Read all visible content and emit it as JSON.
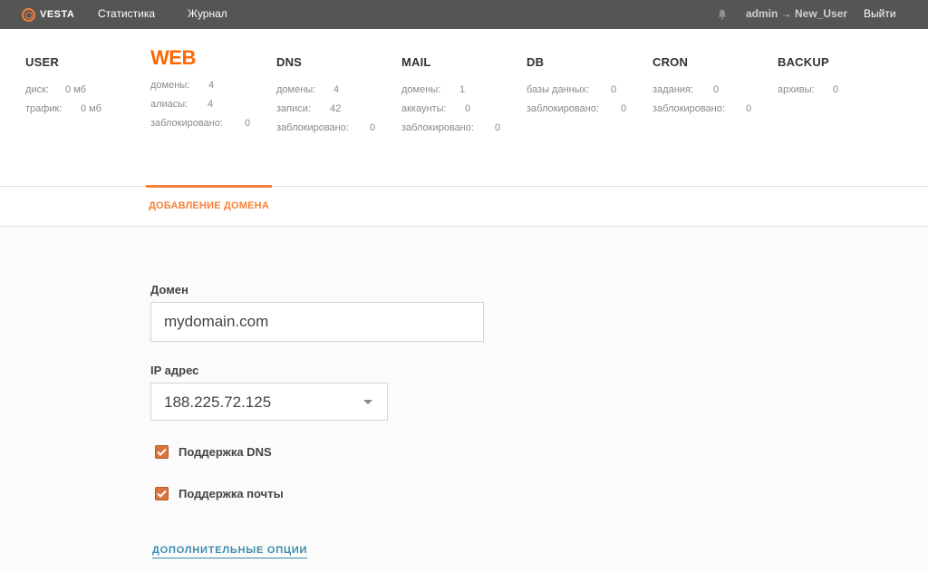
{
  "topbar": {
    "logo_text": "VESTA",
    "nav": [
      "Статистика",
      "Журнал"
    ],
    "user": "admin → New_User",
    "logout": "Выйти"
  },
  "stats": {
    "user": {
      "title": "USER",
      "rows": [
        {
          "label": "диск:",
          "value": "0 мб"
        },
        {
          "label": "трафик:",
          "value": "0 мб"
        }
      ]
    },
    "web": {
      "title": "WEB",
      "rows": [
        {
          "label": "домены:",
          "value": "4"
        },
        {
          "label": "алиасы:",
          "value": "4"
        },
        {
          "label": "заблокировано:",
          "value": "0"
        }
      ]
    },
    "dns": {
      "title": "DNS",
      "rows": [
        {
          "label": "домены:",
          "value": "4"
        },
        {
          "label": "записи:",
          "value": "42"
        },
        {
          "label": "заблокировано:",
          "value": "0"
        }
      ]
    },
    "mail": {
      "title": "MAIL",
      "rows": [
        {
          "label": "домены:",
          "value": "1"
        },
        {
          "label": "аккаунты:",
          "value": "0"
        },
        {
          "label": "заблокировано:",
          "value": "0"
        }
      ]
    },
    "db": {
      "title": "DB",
      "rows": [
        {
          "label": "базы данных:",
          "value": "0"
        },
        {
          "label": "заблокировано:",
          "value": "0"
        }
      ]
    },
    "cron": {
      "title": "CRON",
      "rows": [
        {
          "label": "задания:",
          "value": "0"
        },
        {
          "label": "заблокировано:",
          "value": "0"
        }
      ]
    },
    "backup": {
      "title": "BACKUP",
      "rows": [
        {
          "label": "архивы:",
          "value": "0"
        }
      ]
    }
  },
  "tab": {
    "label": "ДОБАВЛЕНИЕ ДОМЕНА"
  },
  "form": {
    "domain_label": "Домен",
    "domain_value": "mydomain.com",
    "ip_label": "IP адрес",
    "ip_value": "188.225.72.125",
    "dns_support_label": "Поддержка DNS",
    "dns_support_checked": true,
    "mail_support_label": "Поддержка почты",
    "mail_support_checked": true,
    "more_options": "ДОПОЛНИТЕЛЬНЫЕ ОПЦИИ"
  },
  "colors": {
    "topbar": "#555555",
    "accent": "#ff6701",
    "link": "#3a8ca8",
    "checkbox": "#d8743e"
  },
  "icons": [
    "vesta-logo-icon",
    "bell-icon",
    "chevron-down-icon",
    "checkmark-icon"
  ]
}
